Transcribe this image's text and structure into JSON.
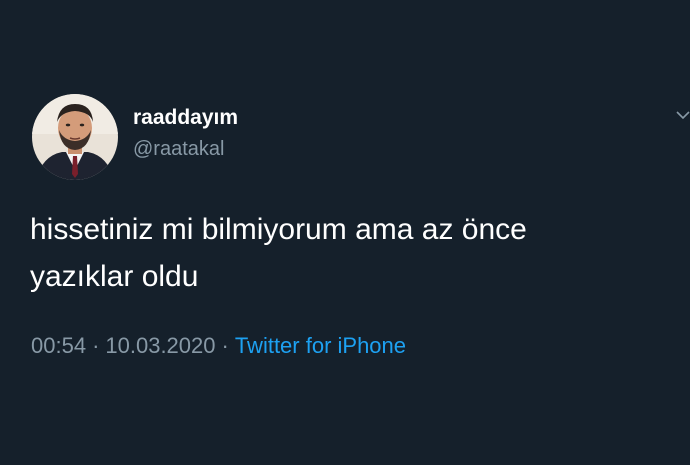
{
  "author": {
    "display_name": "raaddayım",
    "handle": "@raatakal",
    "avatar_icon": "profile-photo"
  },
  "tweet": {
    "lines": [
      "hissetiniz mi bilmiyorum ama az önce",
      "yazıklar oldu"
    ]
  },
  "meta": {
    "time": "00:54",
    "separator": "·",
    "date": "10.03.2020",
    "source": "Twitter for iPhone"
  },
  "colors": {
    "background": "#15202b",
    "text_primary": "#ffffff",
    "text_secondary": "#8899a6",
    "link": "#1da1f2"
  },
  "icons": {
    "menu": "chevron-down-icon"
  }
}
